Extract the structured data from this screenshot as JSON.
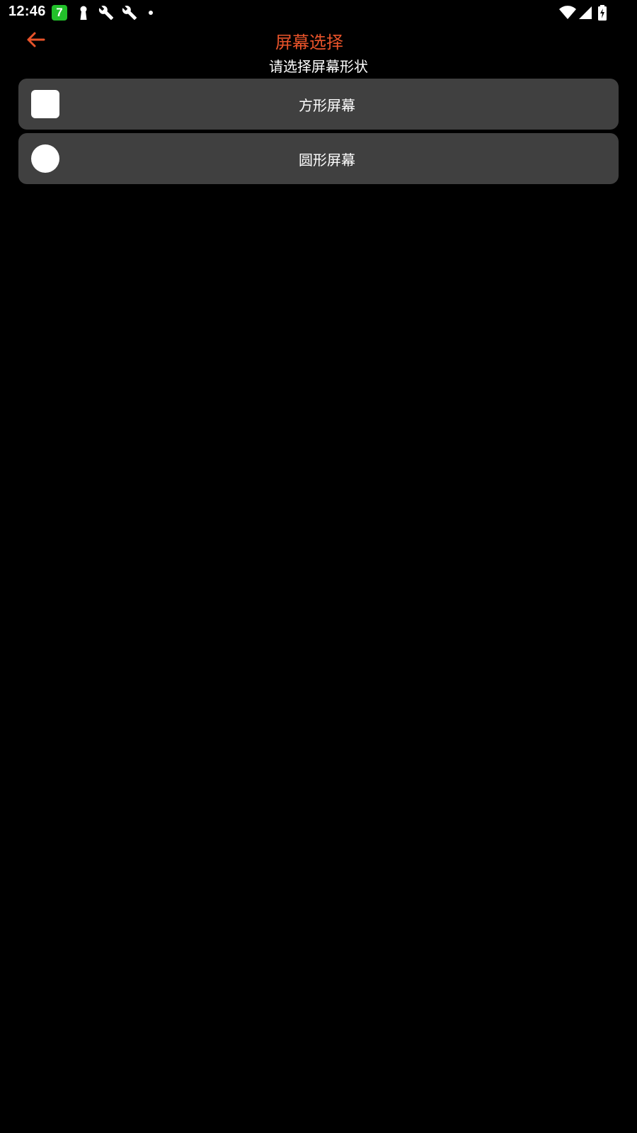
{
  "status_bar": {
    "time": "12:46",
    "app_badge": "7",
    "icons": [
      "app-7-badge",
      "keyhole-icon",
      "wrench-icon",
      "wrench-icon",
      "dot-icon",
      "wifi-icon",
      "cell-signal-icon",
      "battery-charging-icon"
    ]
  },
  "header": {
    "title": "屏幕选择",
    "back_icon": "arrow-left-icon"
  },
  "subtitle": "请选择屏幕形状",
  "options": [
    {
      "label": "方形屏幕",
      "shape": "square"
    },
    {
      "label": "圆形屏幕",
      "shape": "circle"
    }
  ],
  "colors": {
    "accent": "#e8532a",
    "card_bg": "#404040",
    "background": "#000000",
    "badge_green": "#22c02a"
  }
}
